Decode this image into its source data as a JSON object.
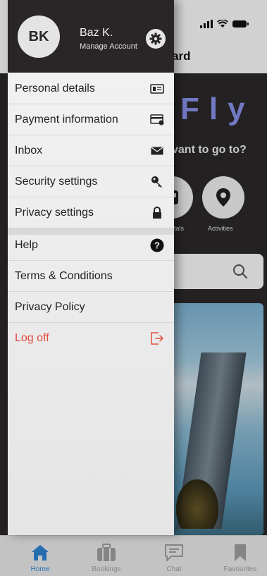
{
  "background": {
    "title_fragment": "ard",
    "brand_fragment": "Fly",
    "question_fragment": "vant to go to?",
    "categories": [
      {
        "label": "ntals",
        "icon": "car-icon"
      },
      {
        "label": "Activities",
        "icon": "location-pin-icon"
      }
    ]
  },
  "drawer": {
    "avatar_initials": "BK",
    "user_name": "Baz K.",
    "manage_account": "Manage Account",
    "settings_icon": "gear-icon",
    "items_group1": [
      {
        "label": "Personal details",
        "icon": "id-card-icon"
      },
      {
        "label": "Payment information",
        "icon": "credit-card-icon"
      },
      {
        "label": "Inbox",
        "icon": "envelope-icon"
      },
      {
        "label": "Security settings",
        "icon": "key-icon"
      },
      {
        "label": "Privacy settings",
        "icon": "lock-icon"
      }
    ],
    "items_group2": [
      {
        "label": "Help",
        "icon": "question-circle-icon"
      },
      {
        "label": "Terms & Conditions",
        "icon": ""
      },
      {
        "label": "Privacy Policy",
        "icon": ""
      },
      {
        "label": "Log off",
        "icon": "logout-icon"
      }
    ]
  },
  "tabbar": {
    "tabs": [
      {
        "label": "Home",
        "icon": "home-icon",
        "active": true
      },
      {
        "label": "Bookings",
        "icon": "suitcase-icon",
        "active": false
      },
      {
        "label": "Chat",
        "icon": "chat-icon",
        "active": false
      },
      {
        "label": "Favourites",
        "icon": "bookmark-icon",
        "active": false
      }
    ]
  },
  "colors": {
    "accent": "#2f86d7",
    "logoff": "#e24a3b",
    "dark": "#2a2627",
    "brand": "#8a93f0"
  }
}
